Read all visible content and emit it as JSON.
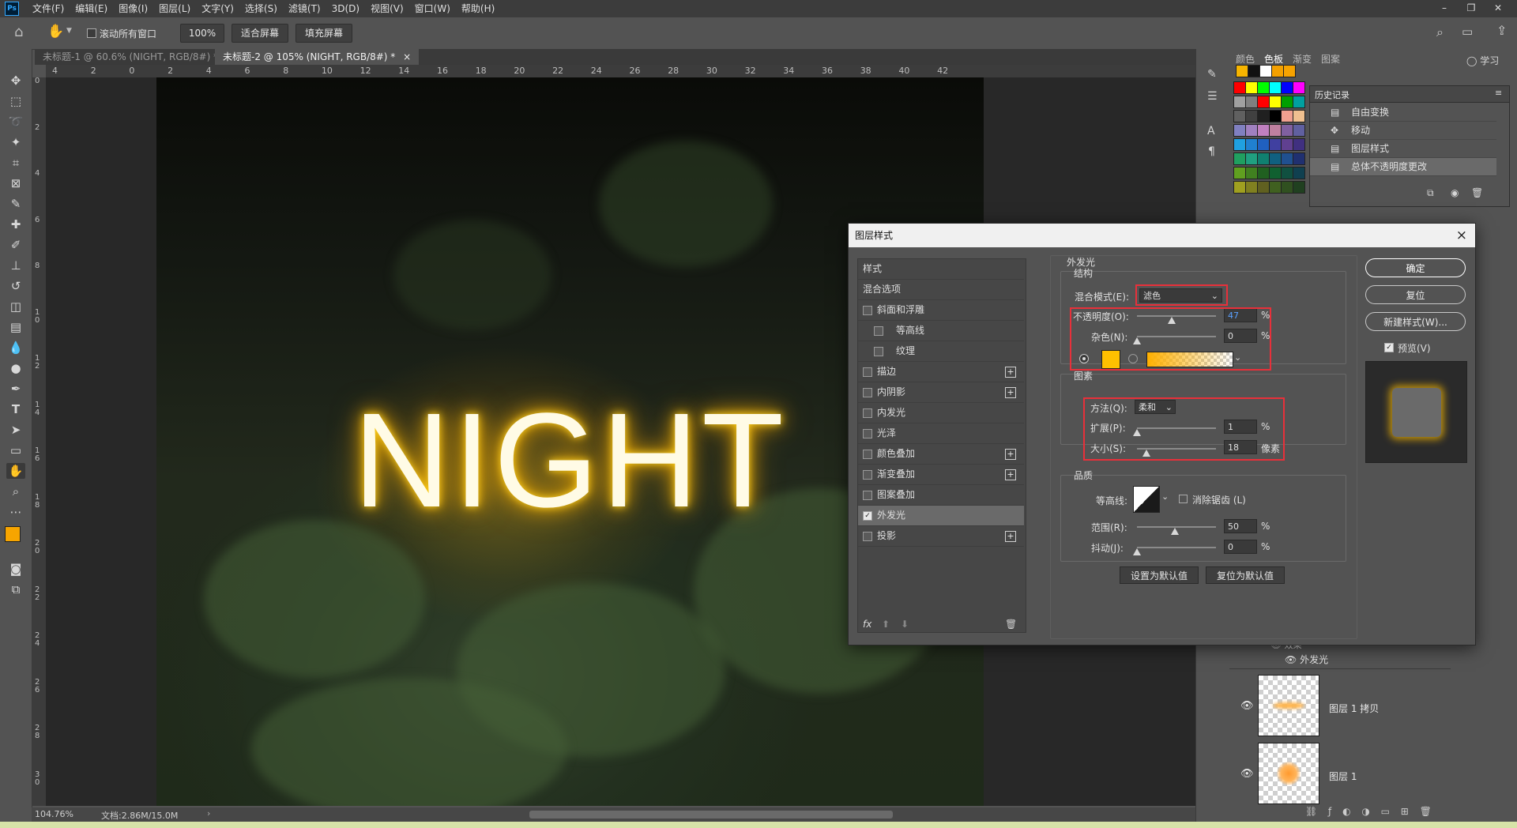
{
  "app": {
    "logo": "Ps",
    "menu": [
      "文件(F)",
      "编辑(E)",
      "图像(I)",
      "图层(L)",
      "文字(Y)",
      "选择(S)",
      "滤镜(T)",
      "3D(D)",
      "视图(V)",
      "窗口(W)",
      "帮助(H)"
    ]
  },
  "options_bar": {
    "scroll_all_windows": "滚动所有窗口",
    "zoom": "100%",
    "fit_screen": "适合屏幕",
    "fill_screen": "填充屏幕"
  },
  "tabs": [
    {
      "label": "未标题-1 @ 60.6% (NIGHT, RGB/8#) *",
      "close": "×"
    },
    {
      "label": "未标题-2 @ 105% (NIGHT, RGB/8#) *",
      "close": "×"
    }
  ],
  "ruler_top": [
    "4",
    "2",
    "0",
    "2",
    "4",
    "6",
    "8",
    "10",
    "12",
    "14",
    "16",
    "18",
    "20",
    "22",
    "24",
    "26",
    "28",
    "30",
    "32",
    "34",
    "36",
    "38",
    "40",
    "42"
  ],
  "ruler_left": [
    "0",
    "2",
    "4",
    "6",
    "8",
    "1\n0",
    "1\n2",
    "1\n4",
    "1\n6",
    "1\n8",
    "2\n0",
    "2\n2",
    "2\n4",
    "2\n6",
    "2\n8",
    "3\n0"
  ],
  "canvas": {
    "text": "NIGHT"
  },
  "status": {
    "zoom": "104.76%",
    "doc": "文档:2.86M/15.0M"
  },
  "swatches_panel": {
    "tabs": [
      "颜色",
      "色板",
      "渐变",
      "图案"
    ],
    "learn": "学习",
    "top_colors": [
      "#f7b500",
      "#111111",
      "#ffffff",
      "#f3a000",
      "#f7a300"
    ],
    "grid": [
      [
        "#ff0000",
        "#ffff00",
        "#00ff00",
        "#00ffff",
        "#0000ff",
        "#ff00ff"
      ],
      [
        "#a0a0a0",
        "#808080",
        "#ff0000",
        "#ffff00",
        "#00a000",
        "#00a0a0"
      ],
      [
        "#606060",
        "#404040",
        "#202020",
        "#000000",
        "#f0a090",
        "#f0c090"
      ],
      [
        "#8080c0",
        "#a080c0",
        "#c080c0",
        "#c080a0",
        "#8060a0",
        "#6060a0"
      ],
      [
        "#20a0e0",
        "#2080d0",
        "#2060c0",
        "#4040a0",
        "#604090",
        "#403080"
      ],
      [
        "#20a060",
        "#20a080",
        "#108070",
        "#106080",
        "#205090",
        "#203070"
      ],
      [
        "#60a020",
        "#408020",
        "#206020",
        "#106030",
        "#105040",
        "#104050"
      ],
      [
        "#a0a020",
        "#808020",
        "#606020",
        "#406020",
        "#305020",
        "#204020"
      ]
    ]
  },
  "history": {
    "title": "历史记录",
    "items": [
      "自由变换",
      "移动",
      "图层样式",
      "总体不透明度更改"
    ]
  },
  "layers": {
    "effects_label": "效果",
    "outer_glow_label": "外发光",
    "items": [
      "图层 1 拷贝",
      "图层 1"
    ]
  },
  "dialog": {
    "title": "图层样式",
    "close": "×",
    "fx_list": [
      {
        "label": "样式",
        "checkbox": false,
        "plus": false,
        "indent": false,
        "checked": false
      },
      {
        "label": "混合选项",
        "checkbox": false,
        "plus": false,
        "indent": false,
        "checked": false
      },
      {
        "label": "斜面和浮雕",
        "checkbox": true,
        "plus": false,
        "indent": false,
        "checked": false
      },
      {
        "label": "等高线",
        "checkbox": true,
        "plus": false,
        "indent": true,
        "checked": false
      },
      {
        "label": "纹理",
        "checkbox": true,
        "plus": false,
        "indent": true,
        "checked": false
      },
      {
        "label": "描边",
        "checkbox": true,
        "plus": true,
        "indent": false,
        "checked": false
      },
      {
        "label": "内阴影",
        "checkbox": true,
        "plus": true,
        "indent": false,
        "checked": false
      },
      {
        "label": "内发光",
        "checkbox": true,
        "plus": false,
        "indent": false,
        "checked": false
      },
      {
        "label": "光泽",
        "checkbox": true,
        "plus": false,
        "indent": false,
        "checked": false
      },
      {
        "label": "颜色叠加",
        "checkbox": true,
        "plus": true,
        "indent": false,
        "checked": false
      },
      {
        "label": "渐变叠加",
        "checkbox": true,
        "plus": true,
        "indent": false,
        "checked": false
      },
      {
        "label": "图案叠加",
        "checkbox": true,
        "plus": false,
        "indent": false,
        "checked": false
      },
      {
        "label": "外发光",
        "checkbox": true,
        "plus": false,
        "indent": false,
        "checked": true
      },
      {
        "label": "投影",
        "checkbox": true,
        "plus": true,
        "indent": false,
        "checked": false
      }
    ],
    "section_title": "外发光",
    "structure": {
      "title": "结构",
      "blend_mode_label": "混合模式(E):",
      "blend_mode_value": "滤色",
      "opacity_label": "不透明度(O):",
      "opacity_value": "47",
      "noise_label": "杂色(N):",
      "noise_value": "0",
      "percent": "%",
      "glow_color": "#ffc000"
    },
    "elements": {
      "title": "图素",
      "method_label": "方法(Q):",
      "method_value": "柔和",
      "spread_label": "扩展(P):",
      "spread_value": "1",
      "size_label": "大小(S):",
      "size_value": "18",
      "percent": "%",
      "px": "像素"
    },
    "quality": {
      "title": "品质",
      "contour_label": "等高线:",
      "anti_alias_label": "消除锯齿 (L)",
      "range_label": "范围(R):",
      "range_value": "50",
      "jitter_label": "抖动(J):",
      "jitter_value": "0",
      "percent": "%"
    },
    "set_default": "设置为默认值",
    "reset_default": "复位为默认值",
    "ok": "确定",
    "reset": "复位",
    "new_style": "新建样式(W)...",
    "preview_label": "预览(V)"
  }
}
